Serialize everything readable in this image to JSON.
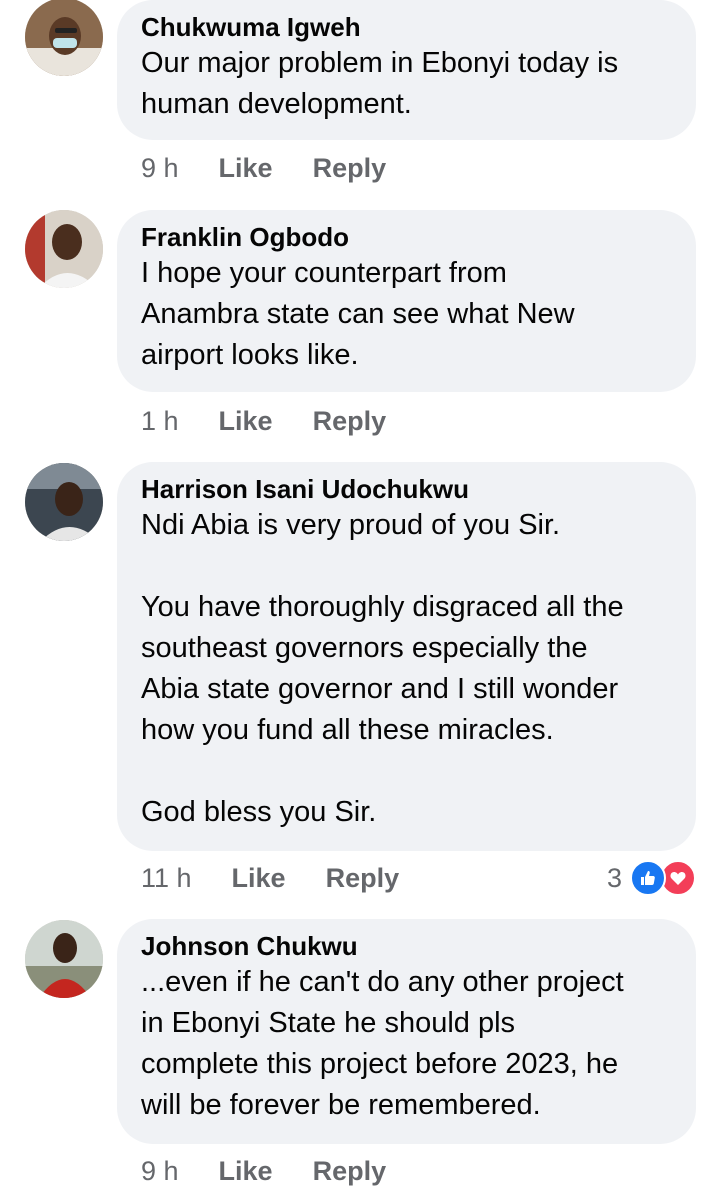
{
  "comments": [
    {
      "author": "Chukwuma Igweh",
      "text": "Our major problem in Ebonyi today is\nhuman development.",
      "time": "9 h",
      "like_label": "Like",
      "reply_label": "Reply"
    },
    {
      "author": "Franklin Ogbodo",
      "text": "I hope your counterpart from\nAnambra state can see what New\nairport looks like.",
      "time": "1 h",
      "like_label": "Like",
      "reply_label": "Reply"
    },
    {
      "author": "Harrison Isani Udochukwu",
      "text": "Ndi Abia is very proud of you  Sir.\n\nYou have thoroughly disgraced all the\nsoutheast governors especially the\nAbia state governor and I still wonder\nhow you fund all  these miracles.\n\nGod bless you Sir.",
      "time": "11 h",
      "like_label": "Like",
      "reply_label": "Reply",
      "reaction_count": "3",
      "reaction_icons": [
        "like-reaction-icon",
        "love-reaction-icon"
      ]
    },
    {
      "author": "Johnson Chukwu",
      "text": "...even if he can't do any other project\nin Ebonyi State he should pls\ncomplete this project before 2023, he\nwill be forever be remembered.",
      "time": "9 h",
      "like_label": "Like",
      "reply_label": "Reply"
    }
  ],
  "colors": {
    "bubble": "#f0f2f5",
    "secondary_text": "#65676b",
    "like_blue": "#1877f2",
    "love_red": "#f33e58"
  }
}
